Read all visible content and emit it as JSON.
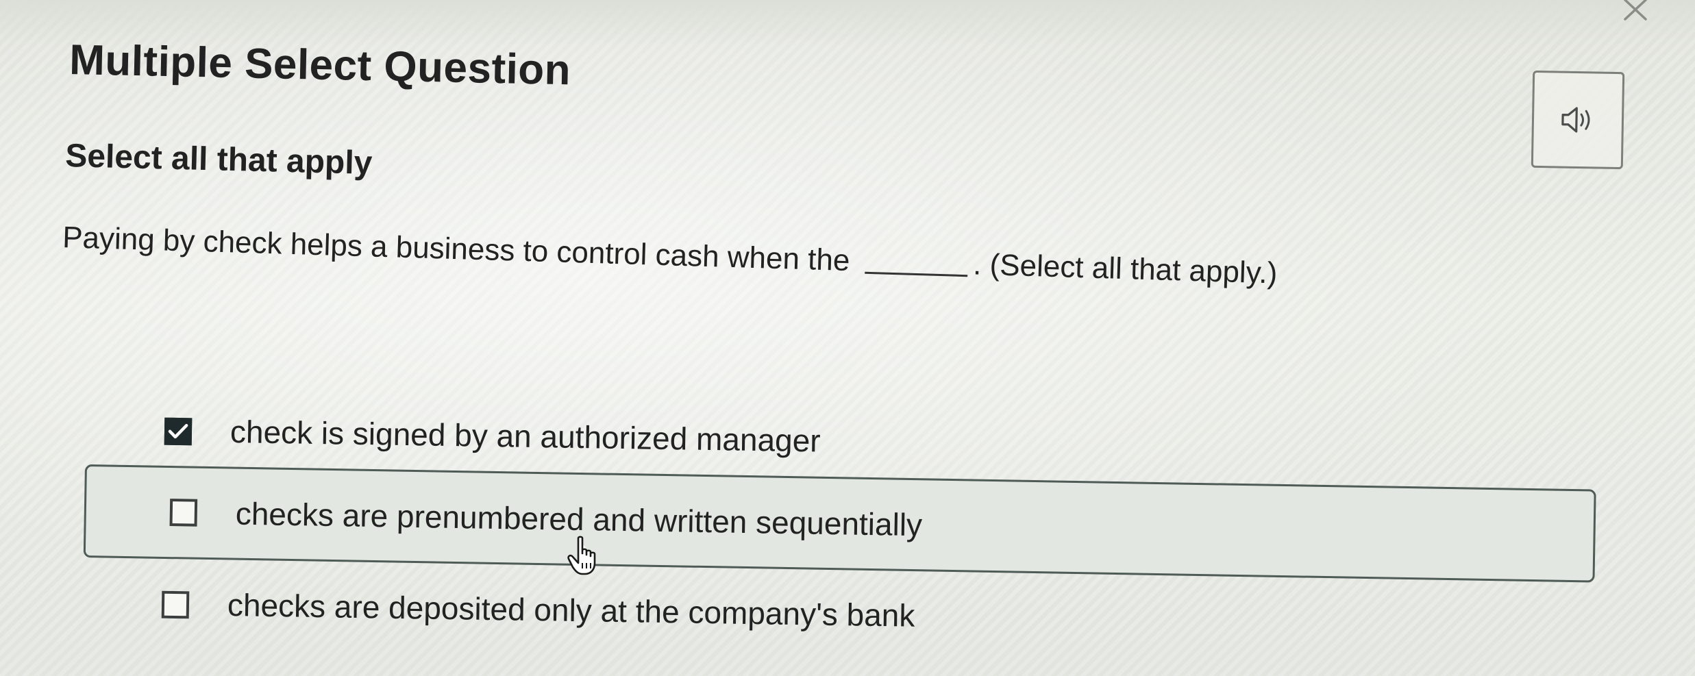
{
  "question": {
    "title": "Multiple Select Question",
    "instruction": "Select all that apply",
    "prompt_before": "Paying by check helps a business to control cash when the",
    "prompt_after": ". (Select all that apply.)"
  },
  "options": [
    {
      "label": "check is signed by an authorized manager",
      "checked": true
    },
    {
      "label": "checks are prenumbered and written sequentially",
      "checked": false
    },
    {
      "label": "checks are deposited only at the company's bank",
      "checked": false
    }
  ],
  "icons": {
    "close": "close-icon",
    "audio": "speaker-icon",
    "cursor": "hand-pointer-icon"
  },
  "colors": {
    "background": "#e9ebe5",
    "text": "#222222",
    "checkbox_checked": "#1e2a2c",
    "hover_row_bg": "#e2e8e1",
    "hover_row_border": "#4f5b57"
  }
}
